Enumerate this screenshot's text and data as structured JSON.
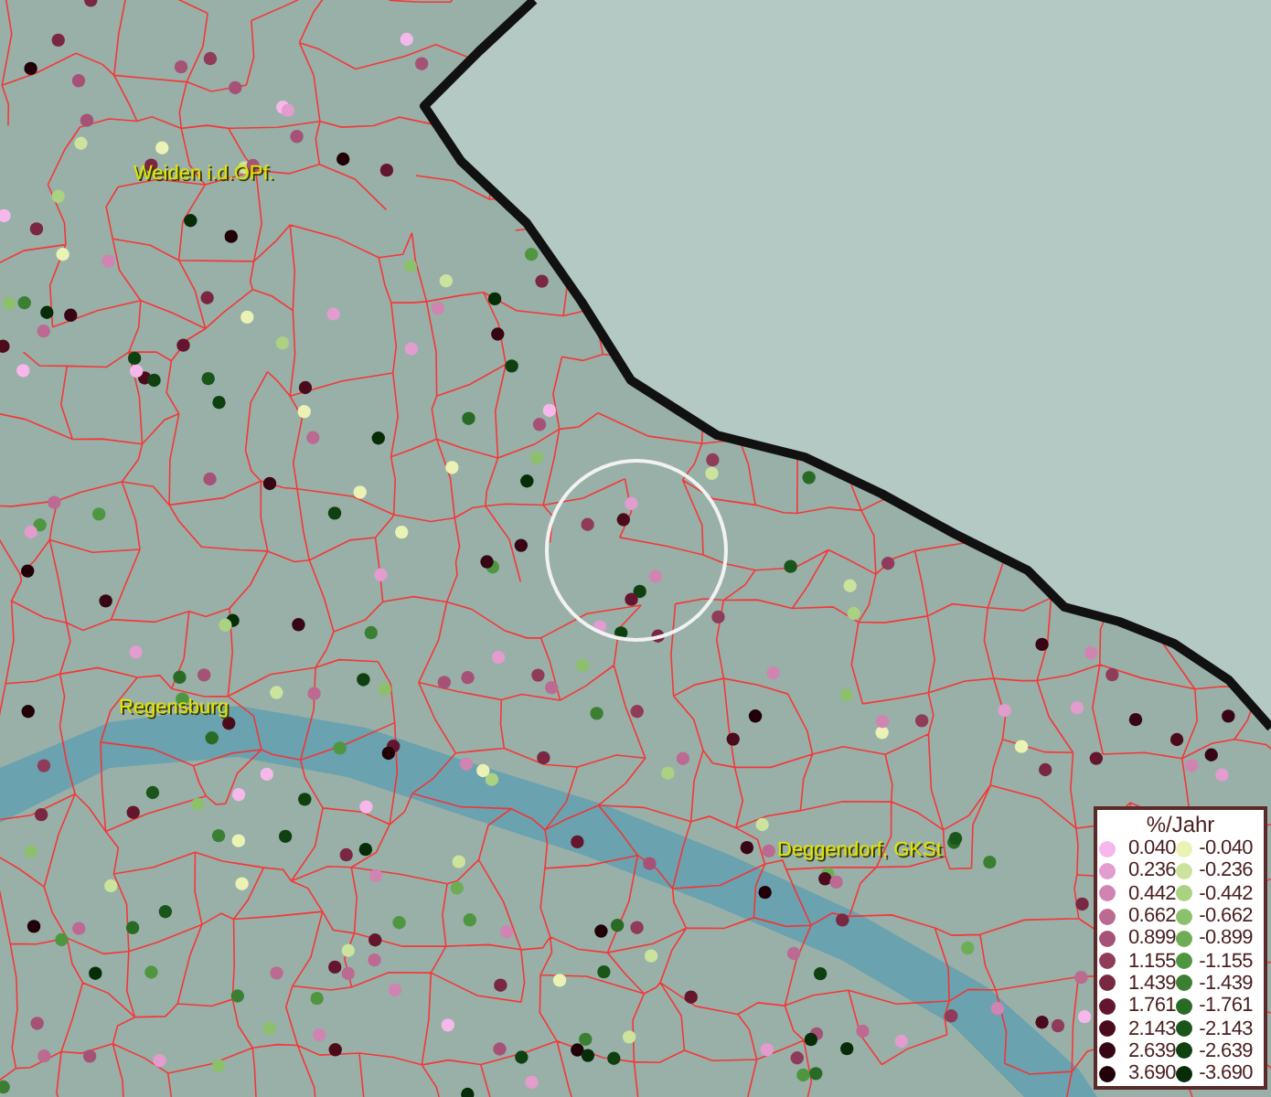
{
  "map": {
    "city_labels": [
      "Weiden i.d.OPf.",
      "Regensburg",
      "Deggendorf, GKSt"
    ]
  },
  "legend": {
    "title": "%/Jahr",
    "columns": [
      [
        {
          "value": "0.040",
          "color": "#f6b8ea"
        },
        {
          "value": "0.236",
          "color": "#e29ccd"
        },
        {
          "value": "0.442",
          "color": "#d084b2"
        },
        {
          "value": "0.662",
          "color": "#bc6a92"
        },
        {
          "value": "0.899",
          "color": "#a65277"
        },
        {
          "value": "1.155",
          "color": "#903b5a"
        },
        {
          "value": "1.439",
          "color": "#7a2742"
        },
        {
          "value": "1.761",
          "color": "#63162d"
        },
        {
          "value": "2.143",
          "color": "#4c0b1d"
        },
        {
          "value": "2.639",
          "color": "#370514"
        },
        {
          "value": "3.690",
          "color": "#210008"
        }
      ],
      [
        {
          "value": "-0.040",
          "color": "#eaf2b4"
        },
        {
          "value": "-0.236",
          "color": "#cbe39c"
        },
        {
          "value": "-0.442",
          "color": "#abd182"
        },
        {
          "value": "-0.662",
          "color": "#8dc06c"
        },
        {
          "value": "-0.899",
          "color": "#6ead55"
        },
        {
          "value": "-1.155",
          "color": "#4f9640"
        },
        {
          "value": "-1.439",
          "color": "#3b8032"
        },
        {
          "value": "-1.761",
          "color": "#296b25"
        },
        {
          "value": "-2.143",
          "color": "#1a5519"
        },
        {
          "value": "-2.639",
          "color": "#0f4010"
        },
        {
          "value": "-3.690",
          "color": "#072c08"
        }
      ]
    ]
  }
}
